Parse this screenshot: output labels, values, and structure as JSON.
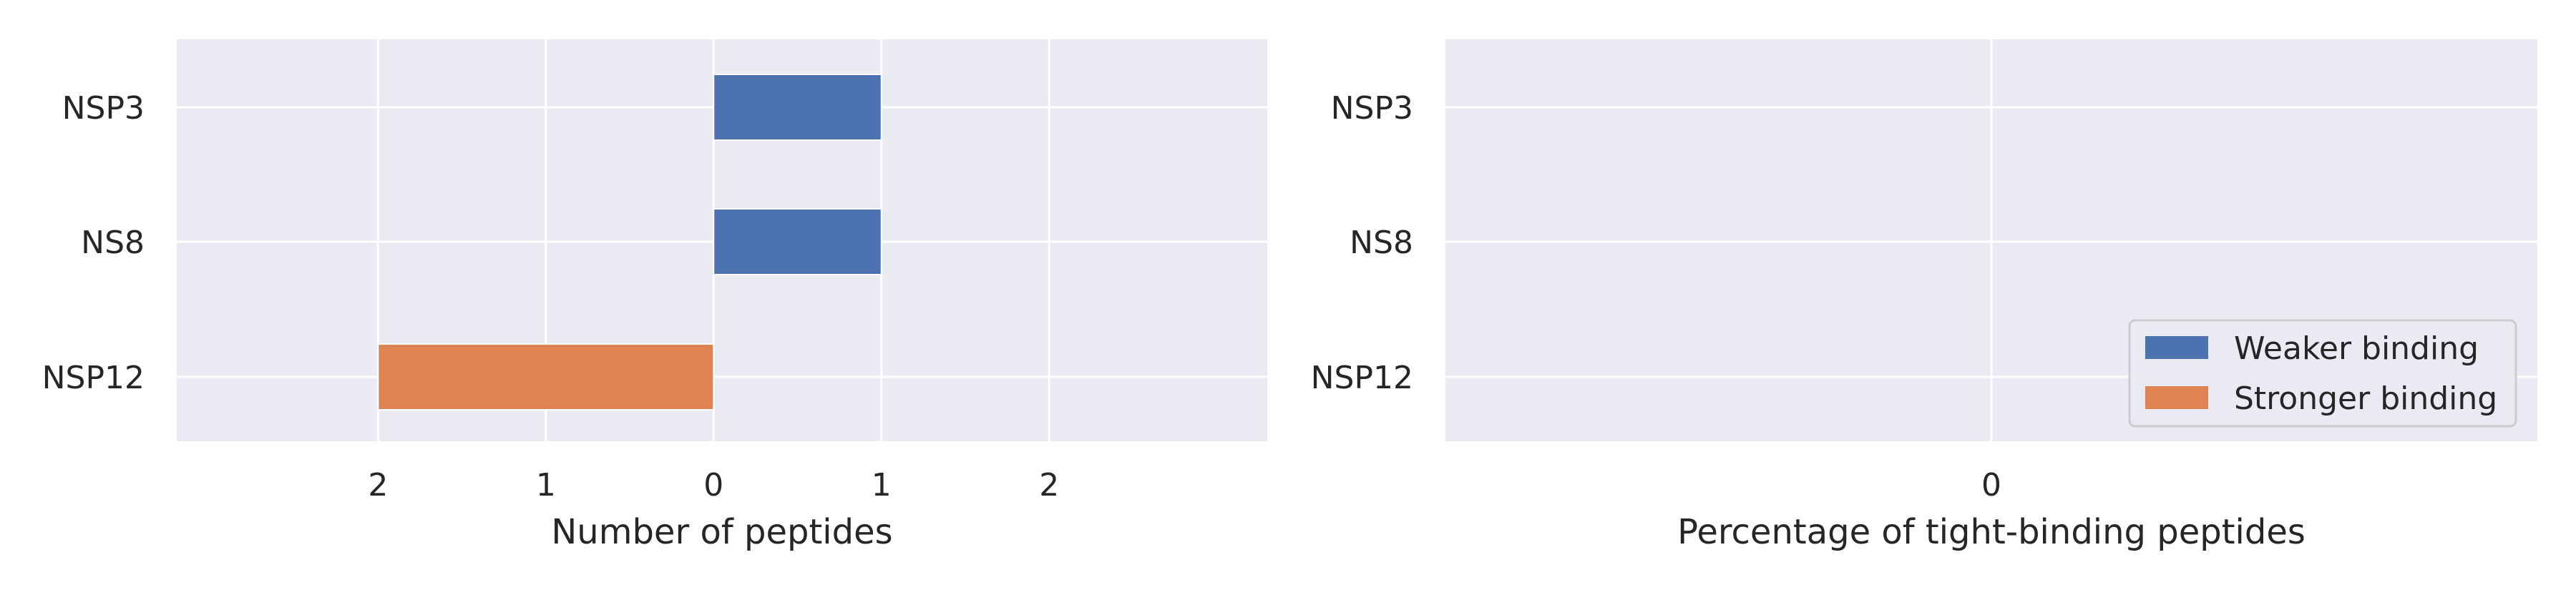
{
  "colors": {
    "weaker": "#4c72b0",
    "stronger": "#dd8452",
    "plot_bg": "#eaeaf2",
    "grid": "#ffffff"
  },
  "chart_data": [
    {
      "type": "bar",
      "orientation": "horizontal",
      "diverging": true,
      "xlabel": "Number of peptides",
      "categories": [
        "NSP3",
        "NS8",
        "NSP12"
      ],
      "xlim": [
        -3.2,
        3.3
      ],
      "x_ticks": [
        -2,
        -1,
        0,
        1,
        2
      ],
      "x_tick_labels": [
        "2",
        "1",
        "0",
        "1",
        "2"
      ],
      "grid": true,
      "series": [
        {
          "name": "Weaker binding",
          "color": "#4c72b0",
          "values": [
            1,
            1,
            0
          ]
        },
        {
          "name": "Stronger binding",
          "color": "#dd8452",
          "values": [
            0,
            0,
            -2
          ]
        }
      ]
    },
    {
      "type": "bar",
      "orientation": "horizontal",
      "xlabel": "Percentage of tight-binding peptides",
      "categories": [
        "NSP3",
        "NS8",
        "NSP12"
      ],
      "x_ticks": [
        0
      ],
      "x_tick_labels": [
        "0"
      ],
      "grid": true,
      "series": [
        {
          "name": "Weaker binding",
          "color": "#4c72b0",
          "values": [
            0,
            0,
            0
          ]
        },
        {
          "name": "Stronger binding",
          "color": "#dd8452",
          "values": [
            0,
            0,
            0
          ]
        }
      ],
      "legend": {
        "placement": "lower-right",
        "entries": [
          "Weaker binding",
          "Stronger binding"
        ]
      }
    }
  ]
}
